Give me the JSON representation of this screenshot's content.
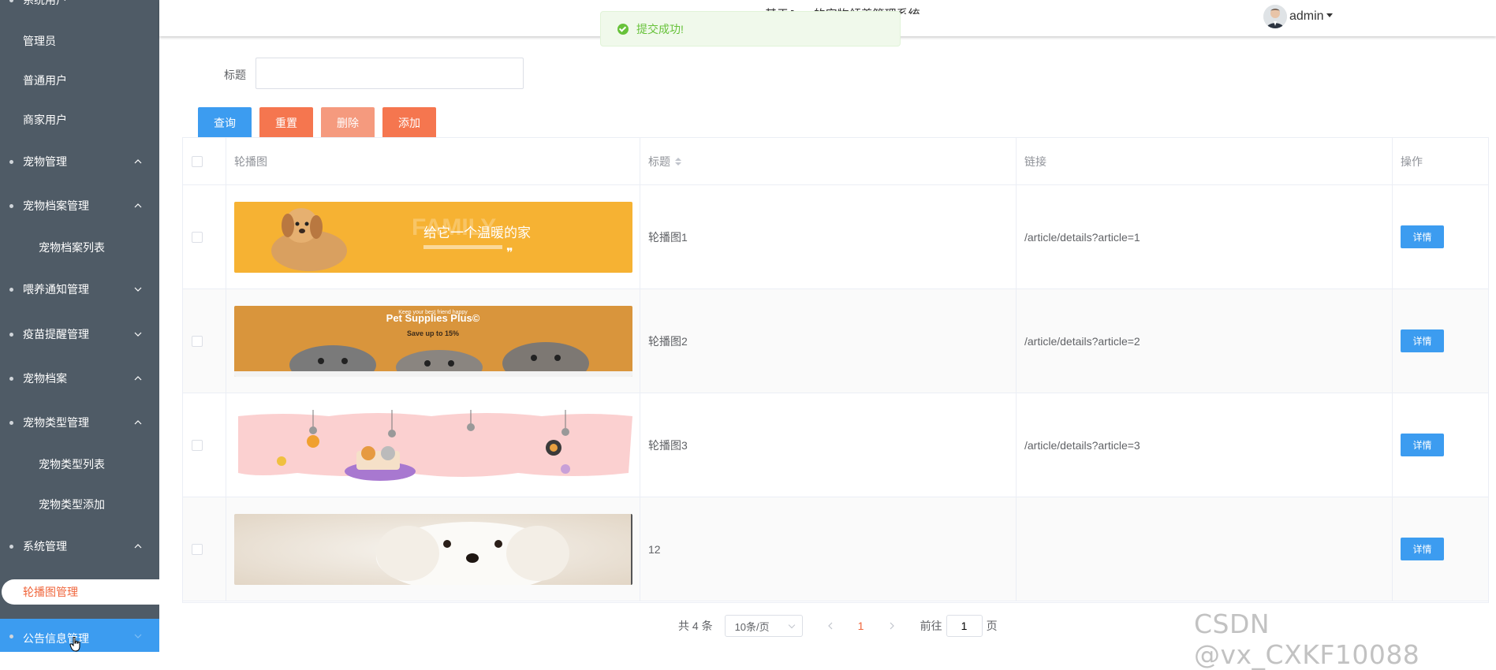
{
  "header": {
    "system_title": "基于Java的宠物领养管理系统",
    "username": "admin"
  },
  "toast": {
    "message": "提交成功!"
  },
  "sidebar": {
    "items": [
      {
        "label": "系统用户",
        "kind": "plain"
      },
      {
        "label": "管理员",
        "kind": "plain"
      },
      {
        "label": "普通用户",
        "kind": "plain"
      },
      {
        "label": "商家用户",
        "kind": "plain"
      },
      {
        "label": "宠物管理",
        "kind": "group",
        "expanded": true
      },
      {
        "label": "宠物档案管理",
        "kind": "group",
        "expanded": true
      },
      {
        "label": "宠物档案列表",
        "kind": "sub"
      },
      {
        "label": "喂养通知管理",
        "kind": "group",
        "expanded": false
      },
      {
        "label": "疫苗提醒管理",
        "kind": "group",
        "expanded": false
      },
      {
        "label": "宠物档案",
        "kind": "group",
        "expanded": true
      },
      {
        "label": "宠物类型管理",
        "kind": "group",
        "expanded": true
      },
      {
        "label": "宠物类型列表",
        "kind": "sub"
      },
      {
        "label": "宠物类型添加",
        "kind": "sub"
      },
      {
        "label": "系统管理",
        "kind": "group",
        "expanded": true
      },
      {
        "label": "轮播图管理",
        "kind": "active"
      },
      {
        "label": "公告信息管理",
        "kind": "group",
        "expanded": false
      }
    ]
  },
  "search": {
    "label": "标题",
    "value": "",
    "placeholder": ""
  },
  "toolbar": {
    "query_label": "查询",
    "reset_label": "重置",
    "delete_label": "删除",
    "add_label": "添加"
  },
  "table": {
    "columns": [
      "轮播图",
      "标题",
      "链接",
      "操作"
    ],
    "detail_label": "详情",
    "rows": [
      {
        "title": "轮播图1",
        "link": "/article/details?article=1",
        "banner_text": "给它一个温暖的家",
        "banner_sub": "FAMILY"
      },
      {
        "title": "轮播图2",
        "link": "/article/details?article=2",
        "banner_text": "Pet Supplies Plus©",
        "banner_sub": "Save up to 15%",
        "banner_top": "Keep your best friend happy"
      },
      {
        "title": "轮播图3",
        "link": "/article/details?article=3"
      },
      {
        "title": "12",
        "link": ""
      }
    ]
  },
  "pagination": {
    "total": "共 4 条",
    "page_size": "10条/页",
    "current": "1",
    "goto_prefix": "前往",
    "goto_value": "1",
    "goto_suffix": "页"
  },
  "watermark": "CSDN @vx_CXKF10088",
  "colors": {
    "sidebar_bg": "#4f5b66",
    "primary": "#3c9cf0",
    "reset": "#f5764f",
    "delete": "#f59a7e",
    "add": "#f5764f",
    "active_text": "#f0663c",
    "success": "#67c23a"
  }
}
